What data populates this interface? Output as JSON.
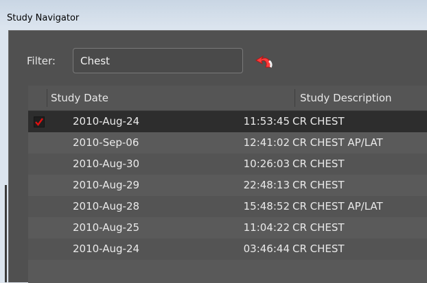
{
  "window": {
    "title": "Study Navigator"
  },
  "filter": {
    "label": "Filter:",
    "value": "Chest",
    "reset_icon": "undo-arrow-icon"
  },
  "table": {
    "columns": [
      "Study Date",
      "Study Description"
    ],
    "rows": [
      {
        "date": "2010-Aug-24",
        "time": "11:53:45",
        "description": "CR CHEST",
        "checked": true
      },
      {
        "date": "2010-Sep-06",
        "time": "12:41:02",
        "description": "CR CHEST AP/LAT",
        "checked": false
      },
      {
        "date": "2010-Aug-30",
        "time": "10:26:03",
        "description": "CR CHEST",
        "checked": false
      },
      {
        "date": "2010-Aug-29",
        "time": "22:48:13",
        "description": "CR CHEST",
        "checked": false
      },
      {
        "date": "2010-Aug-28",
        "time": "15:48:52",
        "description": "CR CHEST AP/LAT",
        "checked": false
      },
      {
        "date": "2010-Aug-25",
        "time": "11:04:22",
        "description": "CR CHEST",
        "checked": false
      },
      {
        "date": "2010-Aug-24",
        "time": "03:46:44",
        "description": "CR CHEST",
        "checked": false
      }
    ]
  },
  "colors": {
    "selected_row": "#2d2d2d",
    "checkmark": "#e01010",
    "reset_icon": "#ff3b3b"
  }
}
